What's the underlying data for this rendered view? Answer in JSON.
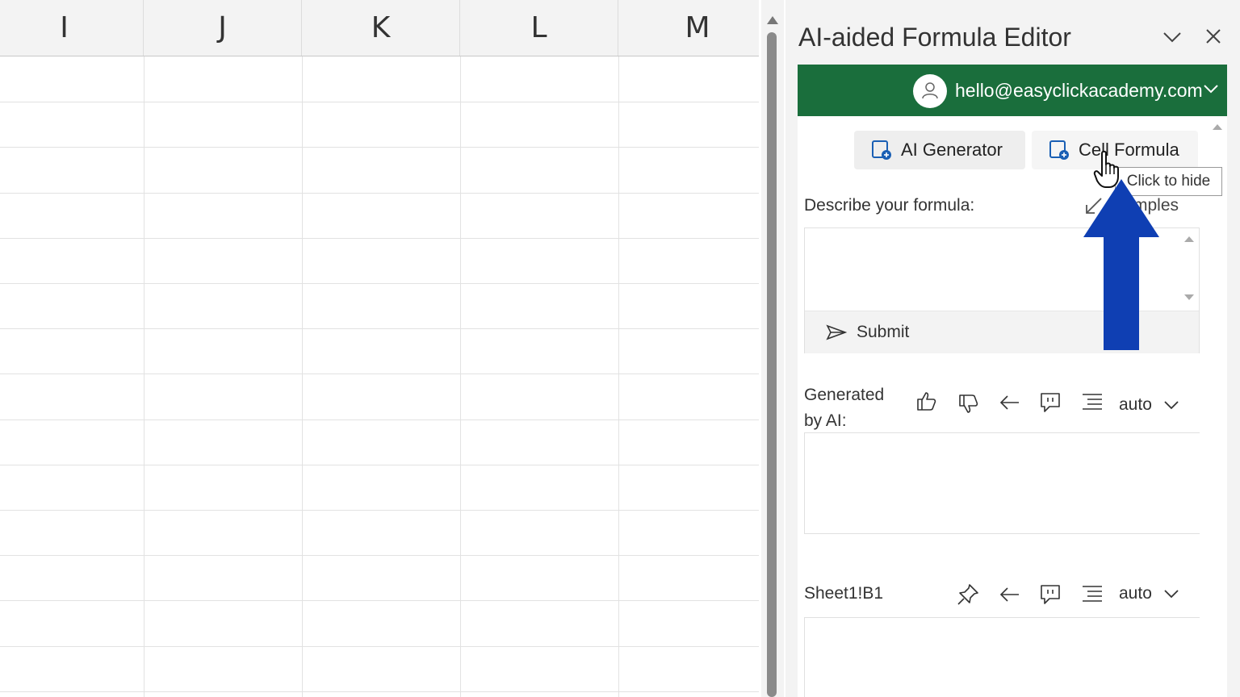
{
  "sheet": {
    "columns": [
      "I",
      "J",
      "K",
      "L",
      "M"
    ]
  },
  "pane": {
    "title": "AI-aided Formula Editor",
    "collapse_icon": "chevron-down-icon",
    "close_icon": "close-icon"
  },
  "account": {
    "email": "hello@easyclickacademy.com",
    "bar_color": "#1a6e3c"
  },
  "tabs": {
    "ai_generator": "AI Generator",
    "cell_formula": "Cell Formula"
  },
  "tooltip": "Click to hide",
  "describe": {
    "label": "Describe your formula:",
    "examples_link": "mples",
    "prompt_value": "",
    "submit_label": "Submit"
  },
  "generated": {
    "label": "Generated by AI:",
    "mode": "auto"
  },
  "cell": {
    "reference": "Sheet1!B1",
    "mode": "auto"
  },
  "annotation": {
    "arrow_color": "#0f3fb3"
  }
}
